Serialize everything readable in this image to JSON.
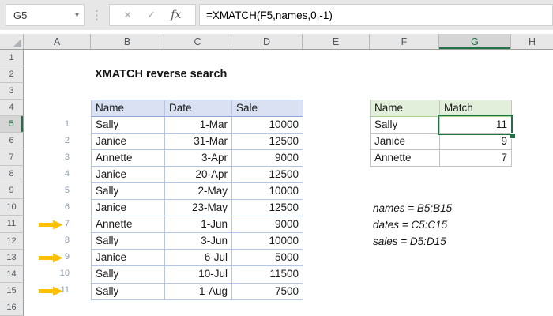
{
  "formula_bar": {
    "name_box_value": "G5",
    "dropdown_icon": "▾",
    "menu_dots_icon": "⋮",
    "cancel_icon": "✕",
    "confirm_icon": "✓",
    "fx_icon": "fx",
    "formula": "=XMATCH(F5,names,0,-1)"
  },
  "grid": {
    "column_headers": [
      "A",
      "B",
      "C",
      "D",
      "E",
      "F",
      "G",
      "H"
    ],
    "row_headers": [
      "1",
      "2",
      "3",
      "4",
      "5",
      "6",
      "7",
      "8",
      "9",
      "10",
      "11",
      "12",
      "13",
      "14",
      "15",
      "16"
    ],
    "selected_column": "G",
    "selected_row": "5",
    "active_cell": "G5"
  },
  "sheet": {
    "title": "XMATCH reverse search",
    "data_table": {
      "headers": {
        "name": "Name",
        "date": "Date",
        "sale": "Sale"
      },
      "rows": [
        {
          "idx": "1",
          "name": "Sally",
          "date": "1-Mar",
          "sale": "10000"
        },
        {
          "idx": "2",
          "name": "Janice",
          "date": "31-Mar",
          "sale": "12500"
        },
        {
          "idx": "3",
          "name": "Annette",
          "date": "3-Apr",
          "sale": "9000"
        },
        {
          "idx": "4",
          "name": "Janice",
          "date": "20-Apr",
          "sale": "12500"
        },
        {
          "idx": "5",
          "name": "Sally",
          "date": "2-May",
          "sale": "10000"
        },
        {
          "idx": "6",
          "name": "Janice",
          "date": "23-May",
          "sale": "12500"
        },
        {
          "idx": "7",
          "name": "Annette",
          "date": "1-Jun",
          "sale": "9000",
          "arrow": true
        },
        {
          "idx": "8",
          "name": "Sally",
          "date": "3-Jun",
          "sale": "10000"
        },
        {
          "idx": "9",
          "name": "Janice",
          "date": "6-Jul",
          "sale": "5000",
          "arrow": true
        },
        {
          "idx": "10",
          "name": "Sally",
          "date": "10-Jul",
          "sale": "11500"
        },
        {
          "idx": "11",
          "name": "Sally",
          "date": "1-Aug",
          "sale": "7500",
          "arrow": true
        }
      ]
    },
    "lookup_table": {
      "headers": {
        "name": "Name",
        "match": "Match"
      },
      "rows": [
        {
          "name": "Sally",
          "match": "11"
        },
        {
          "name": "Janice",
          "match": "9"
        },
        {
          "name": "Annette",
          "match": "7"
        }
      ]
    },
    "notes": [
      "names = B5:B15",
      "dates = C5:C15",
      "sales = D5:D15"
    ]
  },
  "colors": {
    "accent_green": "#217346",
    "table_blue_header": "#D9E1F2",
    "table_blue_border": "#B4C6E7",
    "table_green_header": "#E2EFDA",
    "table_green_border": "#A9D08E",
    "arrow_gold": "#FFC000",
    "row_index_gray": "#8A9BB0"
  }
}
